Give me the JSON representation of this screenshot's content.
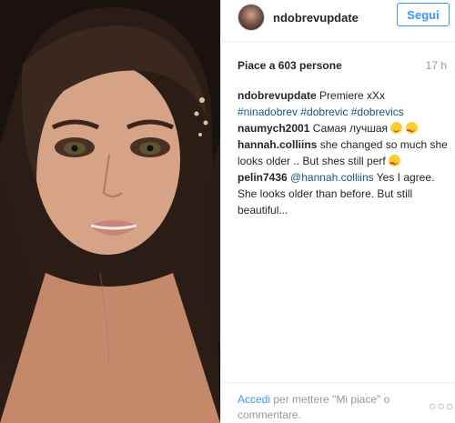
{
  "post": {
    "username": "ndobrevupdate",
    "follow_label": "Segui",
    "likes_text": "Piace a 603 persone",
    "time_ago": "17 h"
  },
  "comments": [
    {
      "user": "ndobrevupdate",
      "text": "Premiere xXx",
      "tags": "#ninadobrev #dobrevic #dobrevics"
    },
    {
      "user": "naumych2001",
      "text": "Самая лучшая"
    },
    {
      "user": "hannah.colliins",
      "text": "she changed so much she looks older .. But shes still perf"
    },
    {
      "user": "pelin7436",
      "mention": "@hannah.colliins",
      "text": "Yes I agree. She looks older than before. But still beautiful..."
    }
  ],
  "footer": {
    "login_link": "Accedi",
    "prompt_text": "per mettere \"Mi piace\" o commentare.",
    "more_icon": "more-options-icon"
  },
  "colors": {
    "accent_blue": "#3897f0",
    "hashtag_blue": "#125688",
    "border": "#efefef",
    "muted": "#999999"
  }
}
